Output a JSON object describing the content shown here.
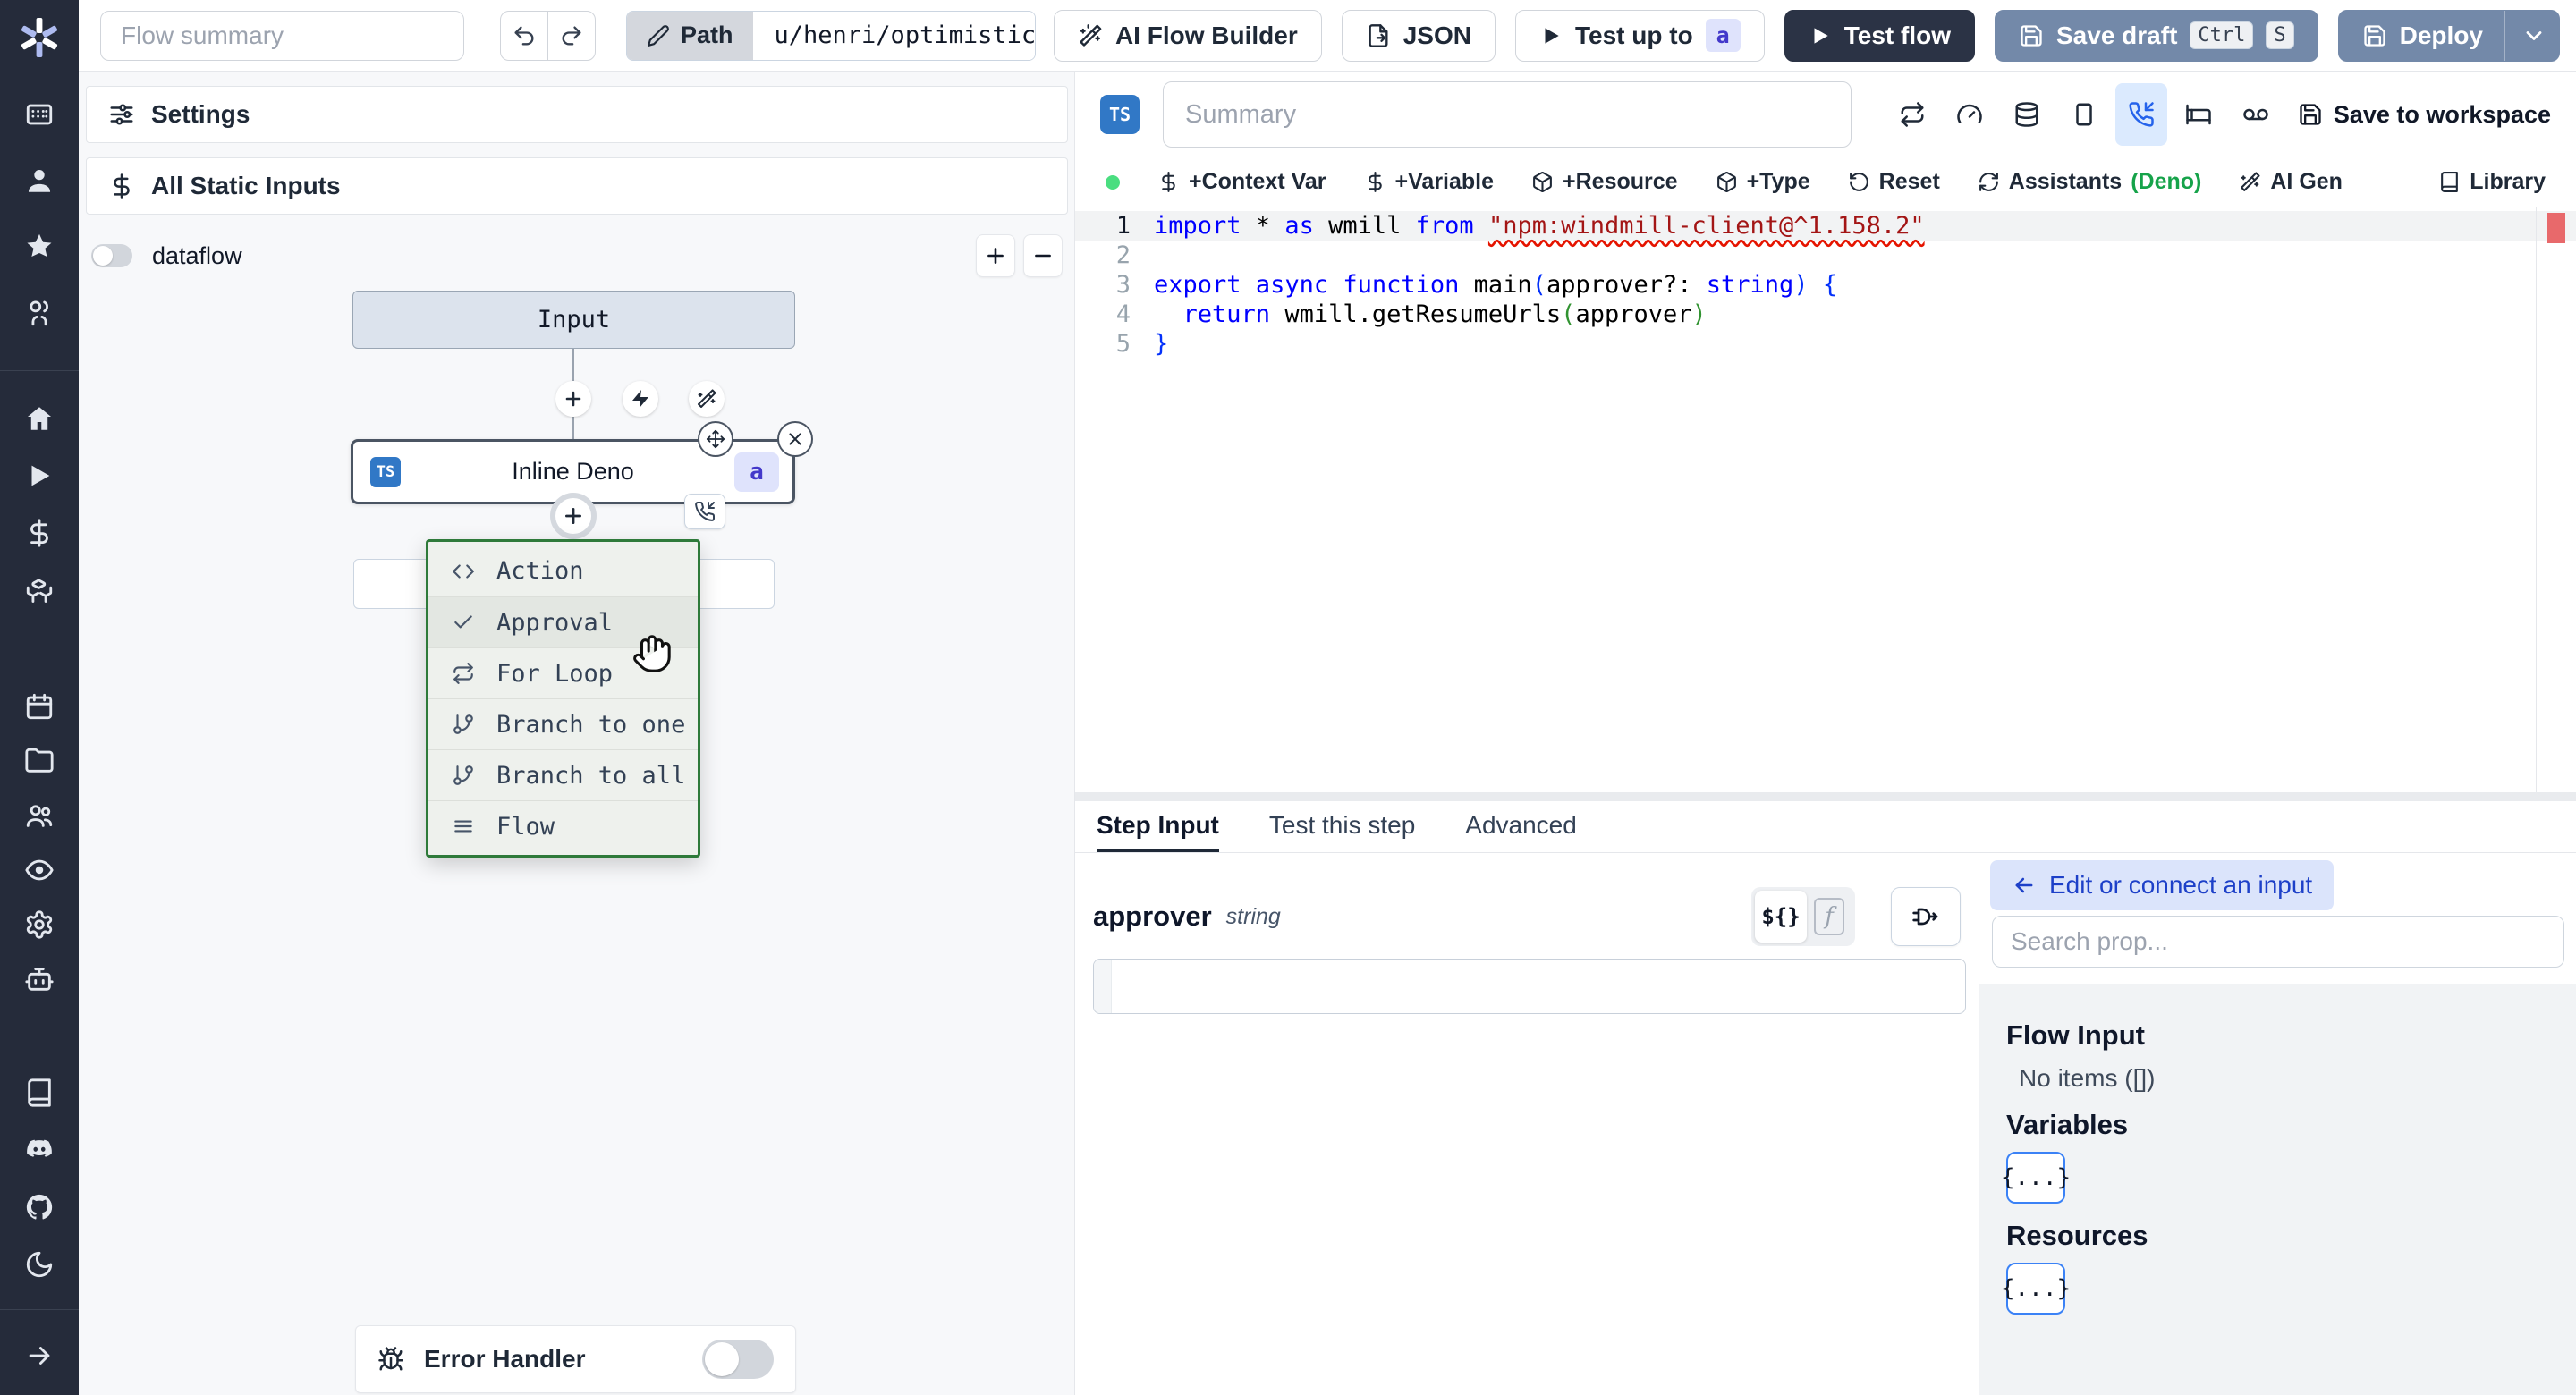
{
  "topbar": {
    "summary_placeholder": "Flow summary",
    "path_label": "Path",
    "path_value": "u/henri/optimistic_flow",
    "ai_builder": "AI Flow Builder",
    "json": "JSON",
    "test_up_to": "Test up to",
    "test_up_to_badge": "a",
    "test_flow": "Test flow",
    "save_draft": "Save draft",
    "kbd": [
      "Ctrl",
      "S"
    ],
    "deploy": "Deploy"
  },
  "rail": {
    "groups": [
      [
        "apps",
        "user",
        "star",
        "team"
      ],
      [
        "home",
        "play",
        "dollar",
        "boxes"
      ],
      [
        "calendar",
        "folder",
        "group",
        "eye",
        "settings",
        "bot"
      ],
      [
        "book",
        "discord",
        "github",
        "moon"
      ]
    ],
    "footer": "arrow-right"
  },
  "flow": {
    "settings": "Settings",
    "static_inputs": "All Static Inputs",
    "dataflow": "dataflow",
    "dataflow_on": false,
    "input_node": "Input",
    "step_node": "Inline Deno",
    "ts_badge": "TS",
    "step_badge": "a",
    "error_handler": "Error Handler",
    "error_handler_on": false,
    "menu": {
      "items": [
        {
          "icon": "code",
          "label": "Action",
          "highlighted": false
        },
        {
          "icon": "check",
          "label": "Approval",
          "highlighted": true
        },
        {
          "icon": "repeat",
          "label": "For Loop",
          "highlighted": false
        },
        {
          "icon": "branch",
          "label": "Branch to one",
          "highlighted": false
        },
        {
          "icon": "branch",
          "label": "Branch to all",
          "highlighted": false
        },
        {
          "icon": "lines",
          "label": "Flow",
          "highlighted": false
        }
      ]
    }
  },
  "editor": {
    "ts_badge": "TS",
    "summary_placeholder": "Summary",
    "toolbar_icons": [
      "repeat",
      "gauge",
      "database",
      "square",
      "phone-incoming",
      "bed",
      "voicemail"
    ],
    "toolbar_active": "phone-incoming",
    "save_workspace": "Save to workspace",
    "status_color": "#4ade80",
    "quick_actions": [
      {
        "icon": "dollar",
        "label": "+Context Var"
      },
      {
        "icon": "dollar",
        "label": "+Variable"
      },
      {
        "icon": "package",
        "label": "+Resource"
      },
      {
        "icon": "package",
        "label": "+Type"
      },
      {
        "icon": "rotate",
        "label": "Reset"
      },
      {
        "icon": "refresh",
        "label": "Assistants",
        "suffix": "(Deno)"
      },
      {
        "icon": "wand",
        "label": "AI Gen"
      }
    ],
    "library_label": "Library",
    "code": {
      "lines": [
        {
          "n": 1,
          "hl": true,
          "seg": [
            [
              "k",
              "import"
            ],
            [
              "t",
              " * "
            ],
            [
              "k",
              "as"
            ],
            [
              "t",
              " wmill "
            ],
            [
              "k",
              "from"
            ],
            [
              "t",
              " "
            ],
            [
              "s",
              "\"npm:windmill-client@^1.158.2\""
            ]
          ]
        },
        {
          "n": 2,
          "hl": false,
          "seg": []
        },
        {
          "n": 3,
          "hl": false,
          "seg": [
            [
              "k",
              "export"
            ],
            [
              "t",
              " "
            ],
            [
              "k",
              "async"
            ],
            [
              "t",
              " "
            ],
            [
              "k",
              "function"
            ],
            [
              "t",
              " main"
            ],
            [
              "b1",
              "("
            ],
            [
              "t",
              "approver?: "
            ],
            [
              "k",
              "string"
            ],
            [
              "b1",
              ")"
            ],
            [
              "t",
              " "
            ],
            [
              "b1",
              "{"
            ]
          ]
        },
        {
          "n": 4,
          "hl": false,
          "seg": [
            [
              "t",
              "  "
            ],
            [
              "k",
              "return"
            ],
            [
              "t",
              " wmill.getResumeUrls"
            ],
            [
              "b2",
              "("
            ],
            [
              "t",
              "approver"
            ],
            [
              "b2",
              ")"
            ]
          ]
        },
        {
          "n": 5,
          "hl": false,
          "seg": [
            [
              "b1",
              "}"
            ]
          ]
        }
      ]
    }
  },
  "step": {
    "tabs": [
      "Step Input",
      "Test this step",
      "Advanced"
    ],
    "active_tab": 0,
    "field_name": "approver",
    "field_type": "string",
    "interp_label": "${}",
    "fx_label": "f"
  },
  "connect": {
    "back_label": "Edit or connect an input",
    "search_placeholder": "Search prop...",
    "sections": [
      {
        "title": "Flow Input",
        "empty": "No items ([])"
      },
      {
        "title": "Variables",
        "chip": "{...}"
      },
      {
        "title": "Resources",
        "chip": "{...}"
      }
    ]
  },
  "colors": {
    "accent_blue": "#2563eb",
    "slate_button": "#7389a9",
    "dark_button": "#2b3345",
    "menu_green": "#2e7a3a",
    "ts_blue": "#3178c6",
    "badge_indigo_bg": "#dfe3fc",
    "badge_indigo_text": "#4338ca",
    "keyword_blue": "#0000ff",
    "string_red": "#a31515",
    "status_green": "#4ade80"
  }
}
